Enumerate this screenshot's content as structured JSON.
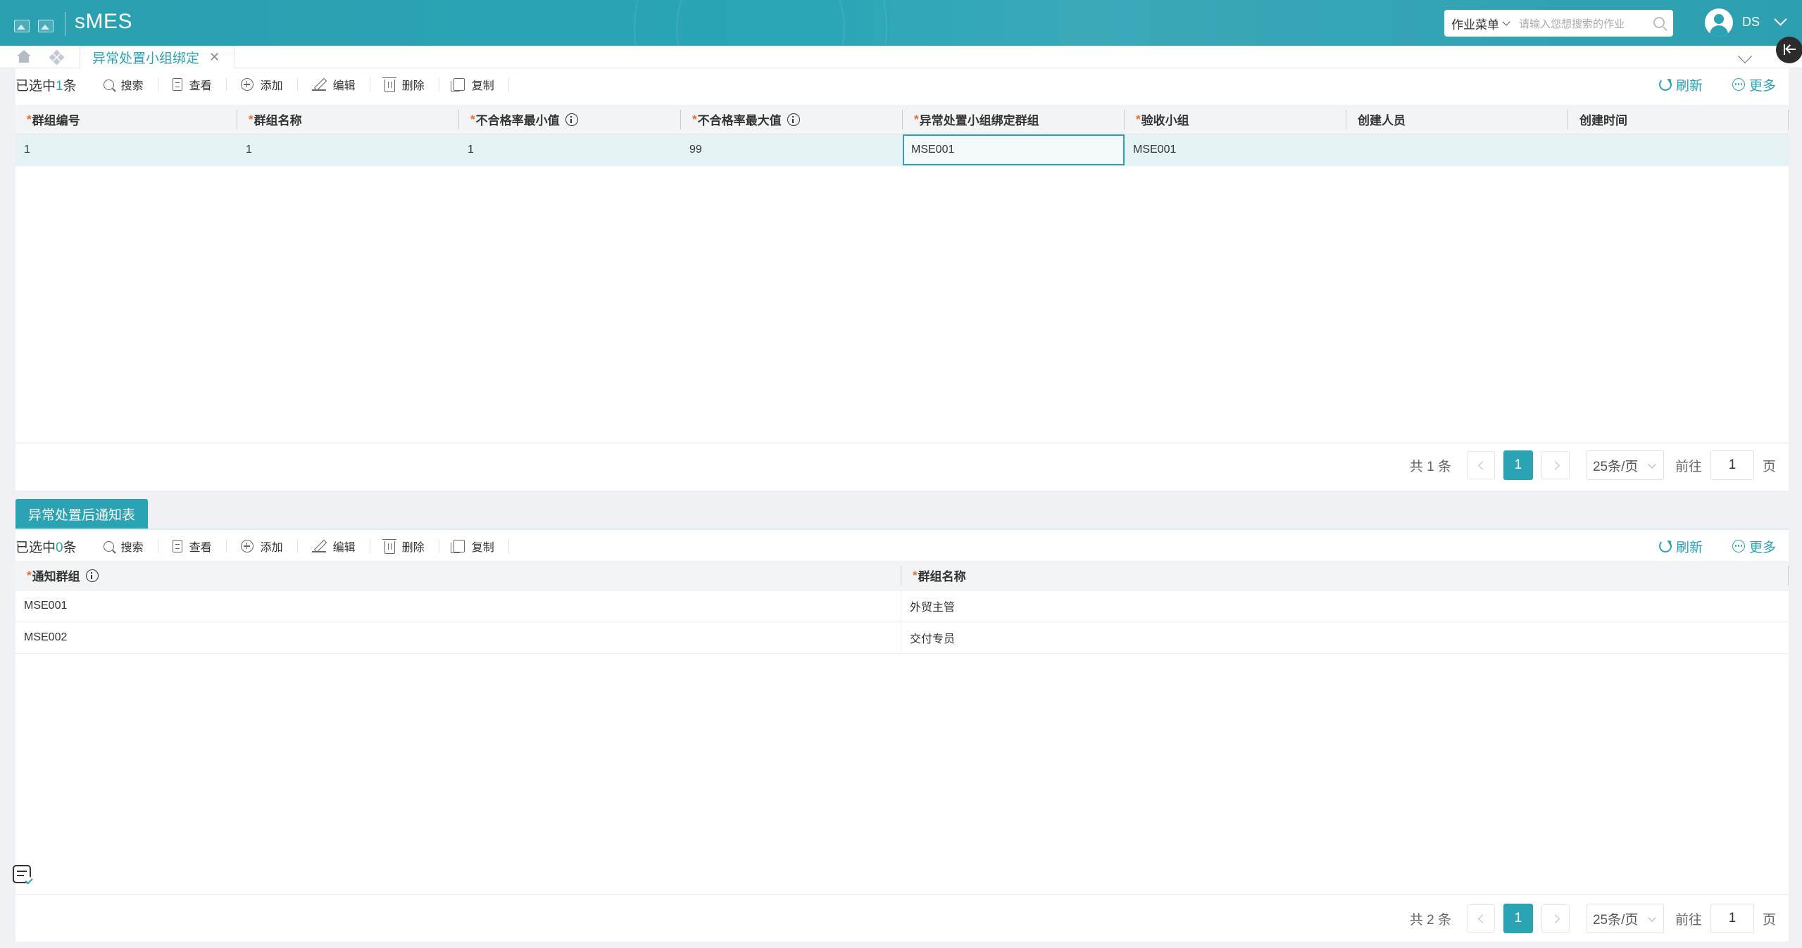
{
  "app": {
    "title": "sMES",
    "menu_select": "作业菜单",
    "search_placeholder": "请输入您想搜索的作业",
    "user": "DS"
  },
  "tabs": [
    {
      "label": "异常处置小组绑定",
      "active": true
    }
  ],
  "toolbar_top": {
    "selected_prefix": "已选中",
    "selected_count": "1",
    "selected_suffix": "条",
    "buttons": [
      "搜索",
      "查看",
      "添加",
      "编辑",
      "删除",
      "复制"
    ],
    "refresh": "刷新",
    "more": "更多"
  },
  "table_top": {
    "columns": [
      {
        "label": "群组编号",
        "required": true,
        "info": false
      },
      {
        "label": "群组名称",
        "required": true,
        "info": false
      },
      {
        "label": "不合格率最小值",
        "required": true,
        "info": true
      },
      {
        "label": "不合格率最大值",
        "required": true,
        "info": true
      },
      {
        "label": "异常处置小组绑定群组",
        "required": true,
        "info": false
      },
      {
        "label": "验收小组",
        "required": true,
        "info": false
      },
      {
        "label": "创建人员",
        "required": false,
        "info": false
      },
      {
        "label": "创建时间",
        "required": false,
        "info": false
      }
    ],
    "rows": [
      [
        "1",
        "1",
        "1",
        "99",
        "MSE001",
        "MSE001",
        "",
        ""
      ]
    ]
  },
  "pager_top": {
    "total": "共 1 条",
    "current_page": "1",
    "page_size": "25条/页",
    "goto_label": "前往",
    "goto_value": "1",
    "page_unit": "页"
  },
  "section2": {
    "title": "异常处置后通知表"
  },
  "toolbar_bottom": {
    "selected_prefix": "已选中",
    "selected_count": "0",
    "selected_suffix": "条",
    "buttons": [
      "搜索",
      "查看",
      "添加",
      "编辑",
      "删除",
      "复制"
    ],
    "refresh": "刷新",
    "more": "更多"
  },
  "table_bottom": {
    "columns": [
      {
        "label": "通知群组",
        "required": true,
        "info": true
      },
      {
        "label": "群组名称",
        "required": true,
        "info": false
      }
    ],
    "rows": [
      [
        "MSE001",
        "外贸主管"
      ],
      [
        "MSE002",
        "交付专员"
      ]
    ]
  },
  "pager_bottom": {
    "total": "共 2 条",
    "current_page": "1",
    "page_size": "25条/页",
    "goto_label": "前往",
    "goto_value": "1",
    "page_unit": "页"
  },
  "colors": {
    "accent": "#2aa3b4",
    "required": "#f26a2a",
    "header_bg": "#2aa3b4"
  }
}
